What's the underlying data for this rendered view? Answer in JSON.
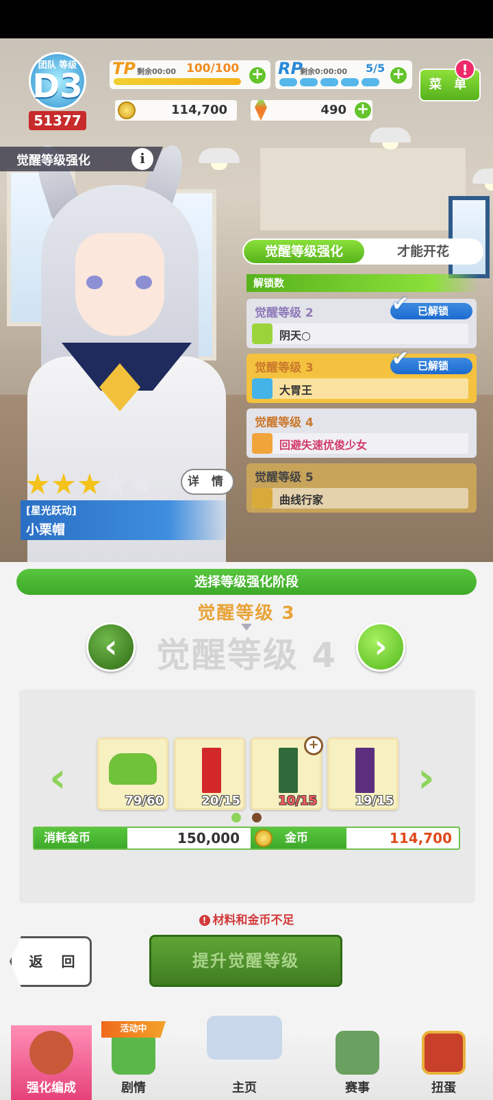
{
  "hud": {
    "team_rank_label": "团队 等级",
    "team_rank_grade": "D3",
    "team_rank_score": "51377",
    "tp": {
      "label": "TP",
      "remaining": "剩余00:00",
      "value": "100/100",
      "fill_fraction": 1.0
    },
    "rp": {
      "label": "RP",
      "remaining": "剩余0:00:00",
      "value": "5/5",
      "pips": 5
    },
    "coins": "114,700",
    "carrots": "490",
    "menu_label": "菜 单",
    "menu_alert": "!",
    "icons": [
      "coin-icon",
      "carrot-icon",
      "plus-icon"
    ]
  },
  "page": {
    "title": "觉醒等级强化",
    "info_glyph": "i"
  },
  "tabs": [
    {
      "label": "觉醒等级强化",
      "active": true
    },
    {
      "label": "才能开花",
      "active": false
    }
  ],
  "unlock_header": "解锁数",
  "levels": [
    {
      "title": "觉醒等级 2",
      "skill": "阴天○",
      "status": "已解锁",
      "bg": "#e3e3ea",
      "title_color": "#8f7ab8",
      "icon_color": "#9bd43a"
    },
    {
      "title": "觉醒等级 3",
      "skill": "大胃王",
      "status": "已解锁",
      "bg": "#f4c23e",
      "title_color": "#c9782c",
      "icon_color": "#43b3e8"
    },
    {
      "title": "觉醒等级 4",
      "skill": "回避失速优俊少女",
      "status": "",
      "bg": "#e3e3ea",
      "title_color": "#c9782c",
      "icon_color": "#f0a43a"
    },
    {
      "title": "觉醒等级 5",
      "skill": "曲线行家",
      "status": "",
      "bg": "#c8a45a",
      "title_color": "#444",
      "icon_color": "#d9aa3a"
    }
  ],
  "character": {
    "stars_filled": 3,
    "stars_total": 5,
    "epithet": "[星光跃动]",
    "name": "小栗帽",
    "detail_label": "详 情"
  },
  "select": {
    "header": "选择等级强化阶段",
    "current_level": "觉醒等级 3",
    "target_level": "觉醒等级 4",
    "prev_glyph": "‹",
    "next_glyph": "›"
  },
  "materials": [
    {
      "name": "shoes-material",
      "qty": "79/60",
      "color": "#6fc23a"
    },
    {
      "name": "red-banner-material",
      "qty": "20/15",
      "color": "#d3282a"
    },
    {
      "name": "green-banner-material",
      "qty": "10/15",
      "color": "#2f6a3a"
    },
    {
      "name": "purple-banner-material",
      "qty": "19/15",
      "color": "#5b2f7e"
    }
  ],
  "materials_arrows": {
    "prev": "‹",
    "next": "›"
  },
  "zoom_glyph": "+",
  "cost": {
    "label": "消耗金币",
    "value": "150,000",
    "coins_label": "金币",
    "coins_value": "114,700"
  },
  "warning": "材料和金币不足",
  "warning_glyph": "!",
  "buttons": {
    "back": "返 回",
    "upgrade": "提升觉醒等级"
  },
  "nav": {
    "event_tag": "活动中",
    "items": [
      {
        "label": "强化编成",
        "active": true
      },
      {
        "label": "剧情",
        "active": false
      },
      {
        "label": "主页",
        "active": false
      },
      {
        "label": "赛事",
        "active": false
      },
      {
        "label": "扭蛋",
        "active": false
      }
    ]
  },
  "colors": {
    "accent_green": "#56b21c",
    "alert_pink": "#ee2a6a",
    "cost_red": "#e04a1a"
  }
}
